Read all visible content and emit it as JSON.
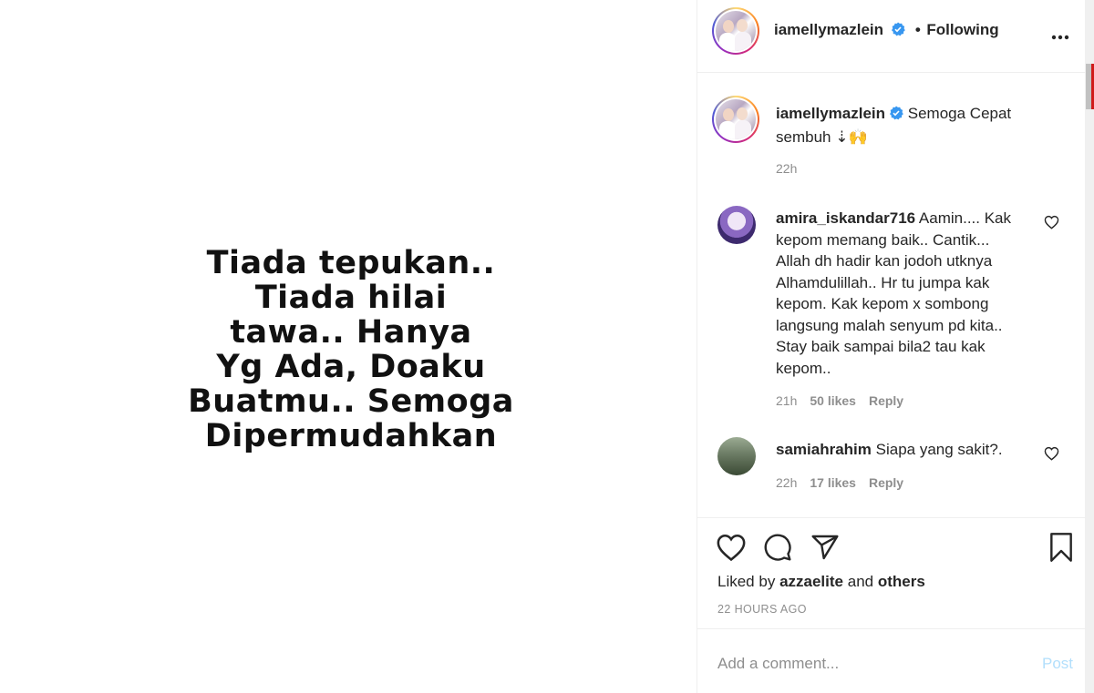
{
  "media": {
    "lines": [
      "Tiada tepukan..",
      "Tiada hilai",
      "tawa.. Hanya",
      "Yg Ada, Doaku",
      "Buatmu.. Semoga",
      "Dipermudahkan"
    ]
  },
  "header": {
    "username": "iamellymazlein",
    "separator": "•",
    "follow_status": "Following",
    "more_icon": "more-horizontal-icon"
  },
  "caption": {
    "username": "iamellymazlein",
    "text": "Semoga Cepat sembuh ⇣🙌",
    "time": "22h"
  },
  "comments": [
    {
      "username": "amira_iskandar716",
      "text": "Aamin.... Kak kepom memang baik.. Cantik... Allah dh hadir kan jodoh utknya Alhamdulillah.. Hr tu jumpa kak kepom. Kak kepom x sombong langsung malah senyum pd kita.. Stay baik sampai bila2 tau kak kepom..",
      "time": "21h",
      "likes": "50 likes",
      "reply": "Reply"
    },
    {
      "username": "samiahrahim",
      "text": "Siapa yang sakit?.",
      "time": "22h",
      "likes": "17 likes",
      "reply": "Reply"
    }
  ],
  "actions": {
    "icons": [
      "heart-icon",
      "comment-icon",
      "share-icon",
      "bookmark-icon"
    ],
    "liked_prefix": "Liked by",
    "liked_user": "azzaelite",
    "liked_and": "and",
    "liked_others": "others",
    "time_ago": "22 HOURS AGO"
  },
  "add_comment": {
    "placeholder": "Add a comment...",
    "post_label": "Post"
  },
  "colors": {
    "verified": "#3897f0",
    "muted": "#8e8e8e",
    "post_disabled": "#b2dffc"
  }
}
